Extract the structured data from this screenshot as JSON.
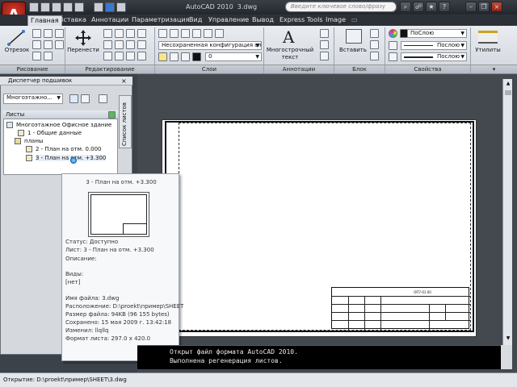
{
  "title_bar": {
    "app_title": "AutoCAD 2010",
    "file_name": "3.dwg",
    "search_placeholder": "Введите ключевое слово/фразу"
  },
  "app_button": {
    "label": "A"
  },
  "ribbon": {
    "tabs": [
      "Главная",
      "Вставка",
      "Аннотации",
      "Параметризация",
      "Вид",
      "Управление",
      "Вывод",
      "Express Tools",
      "Image"
    ],
    "active_tab": "Главная",
    "panels": {
      "draw": {
        "title": "Рисование",
        "tool_label": "Отрезок"
      },
      "modify": {
        "title": "Редактирование",
        "tool_label": "Перенести"
      },
      "layers": {
        "title": "Слои",
        "state_combo": "Несохраненная конфигурация сл",
        "layer_combo": "0"
      },
      "annotations": {
        "title": "Аннотации",
        "text_label_1": "Многострочный",
        "text_label_2": "текст"
      },
      "block": {
        "title": "Блок",
        "insert_label": "Вставить"
      },
      "properties": {
        "title": "Свойства",
        "color_combo": "ПоСлою",
        "linetype_combo": "Послою",
        "lineweight_combo": "Послою"
      },
      "utilities": {
        "label": "Утилиты"
      }
    }
  },
  "palette": {
    "title": "Диспетчер подшивок",
    "combo_value": "Многоэтажно...",
    "side_tab": "Список листов",
    "tree_header": "Листы",
    "tree": {
      "root": "Многоэтажное Офисное здание",
      "item_1": "1 - Общие данные",
      "group": "планы",
      "item_2": "2 - План на отм. 0.000",
      "item_3": "3 - План на отм. +3.300"
    }
  },
  "tooltip": {
    "title": "3 - План на отм. +3.300",
    "status": "Статус: Доступно",
    "sheet": "Лист: 3 - План на отм. +3.300",
    "description": "Описание:",
    "views_label": "Виды:",
    "views_value": "[нет]",
    "file_name": "Имя файла: 3.dwg",
    "location": "Расположение: D:\\proekt\\пример\\SHEET",
    "file_size": "Размер файла: 94KB (96 155 bytes)",
    "saved": "Сохранено: 15 мая 2009 г.  13:42:18",
    "changed_by": "Изменил: llqllq",
    "sheet_format": "Формат листа: 297.0 x 420.0"
  },
  "drawing": {
    "stamp_code": "ОП7-01.00"
  },
  "command_line": {
    "line_1": "Открыт файл формата AutoCAD 2010.",
    "line_2": "Выполнена регенерация листов."
  },
  "status_bar": {
    "text": "Открытие: D:\\proekt\\пример\\SHEET\\3.dwg"
  },
  "colors": {
    "accent_red": "#c8281a",
    "ribbon_bg": "#dfe3e8",
    "dark_chrome": "#2c3138"
  }
}
